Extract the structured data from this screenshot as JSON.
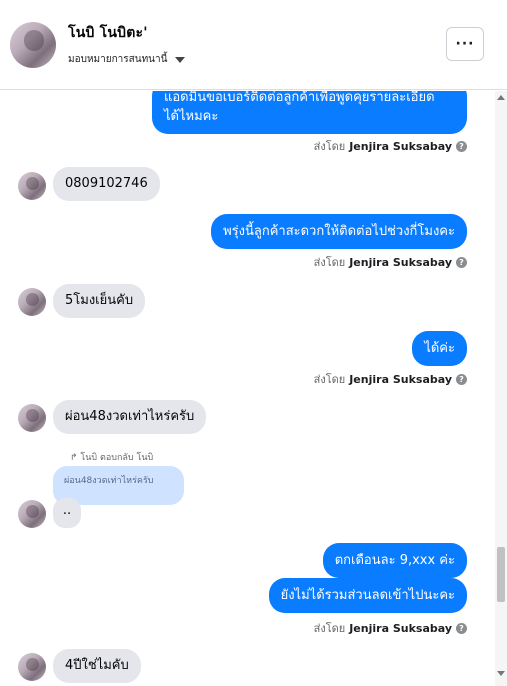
{
  "header": {
    "contact_name": "โนบิ โนบิตะ'",
    "assign_label": "มอบหมายการสนทนานี้",
    "more_label": "···"
  },
  "messages": [
    {
      "kind": "out",
      "text_line1": "แอดมินขอเบอร์ติดต่อลูกค้าเพื่อพูดคุยรายละเอียด",
      "text_line2": "ได้ไหมคะ"
    },
    {
      "kind": "sent_by",
      "prefix": "ส่งโดย",
      "name": "Jenjira Suksabay"
    },
    {
      "kind": "in",
      "text": "0809102746"
    },
    {
      "kind": "out",
      "text": "พรุ่งนี้ลูกค้าสะดวกให้ติดต่อไปช่วงกี่โมงคะ"
    },
    {
      "kind": "sent_by",
      "prefix": "ส่งโดย",
      "name": "Jenjira Suksabay"
    },
    {
      "kind": "in",
      "text": "5โมงเย็นคับ"
    },
    {
      "kind": "out",
      "text": "ได้ค่ะ"
    },
    {
      "kind": "sent_by",
      "prefix": "ส่งโดย",
      "name": "Jenjira Suksabay"
    },
    {
      "kind": "in",
      "text": "ผ่อน48งวดเท่าไหร่ครับ"
    },
    {
      "kind": "reply",
      "label": "โนบิ ตอบกลับ โนบิ",
      "quoted": "ผ่อน48งวดเท่าไหร่ครับ",
      "text": ".."
    },
    {
      "kind": "out",
      "text": "ตกเดือนละ 9,xxx ค่ะ"
    },
    {
      "kind": "out",
      "text": "ยังไม่ได้รวมส่วนลดเข้าไปนะคะ"
    },
    {
      "kind": "sent_by",
      "prefix": "ส่งโดย",
      "name": "Jenjira Suksabay"
    },
    {
      "kind": "in",
      "text": "4ปีใช่ไมคับ"
    }
  ],
  "icons": {
    "info": "info-icon",
    "caret": "caret-down-icon",
    "reply": "reply-arrow-icon"
  },
  "colors": {
    "outgoing_bubble": "#0a7cff",
    "incoming_bubble": "#e4e6eb",
    "quoted_bubble": "#cfe2ff"
  }
}
